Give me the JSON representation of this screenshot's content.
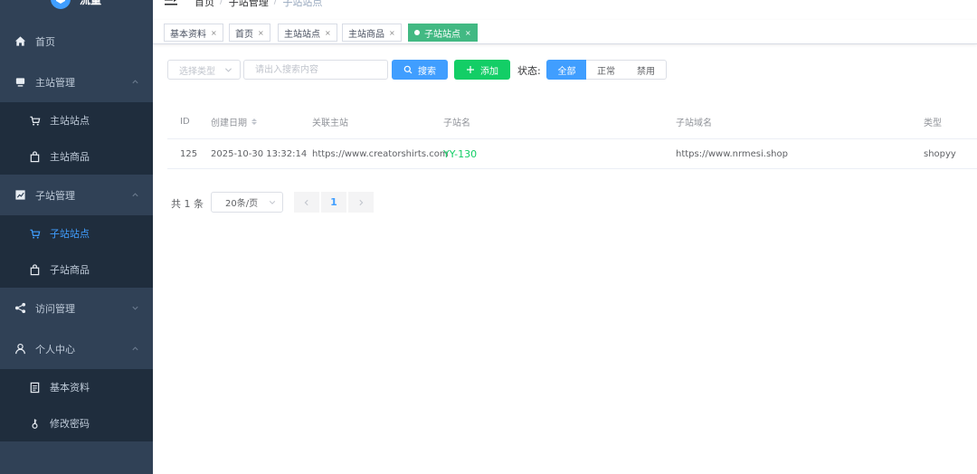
{
  "app": {
    "logo_text": "流量"
  },
  "sidebar": {
    "items": [
      {
        "label": "首页"
      },
      {
        "label": "主站管理"
      },
      {
        "label": "主站站点"
      },
      {
        "label": "主站商品"
      },
      {
        "label": "子站管理"
      },
      {
        "label": "子站站点"
      },
      {
        "label": "子站商品"
      },
      {
        "label": "访问管理"
      },
      {
        "label": "个人中心"
      },
      {
        "label": "基本资料"
      },
      {
        "label": "修改密码"
      }
    ],
    "active_item": "子站站点"
  },
  "breadcrumb": {
    "items": [
      "首页",
      "子站管理",
      "子站站点"
    ],
    "separator": "/"
  },
  "tags": {
    "items": [
      {
        "label": "基本资料"
      },
      {
        "label": "首页"
      },
      {
        "label": "主站站点"
      },
      {
        "label": "主站商品"
      },
      {
        "label": "子站站点"
      }
    ],
    "close_glyph": "×",
    "active_tag": "子站站点"
  },
  "toolbar": {
    "type_select_placeholder": "选择类型",
    "search_placeholder": "请出入搜索内容",
    "search_button": "搜索",
    "add_button": "添加",
    "status_label": "状态:",
    "status_options": [
      "全部",
      "正常",
      "禁用"
    ],
    "status_selected": "全部"
  },
  "table": {
    "columns": [
      "ID",
      "创建日期",
      "关联主站",
      "子站名",
      "子站域名",
      "类型"
    ],
    "rows": [
      {
        "id": "125",
        "created": "2025-10-30 13:32:14",
        "main_site": "https://www.creatorshirts.com",
        "sub_name": "YY-130",
        "sub_domain": "https://www.nrmesi.shop",
        "type": "shopyy"
      }
    ]
  },
  "pagination": {
    "total": "共 1 条",
    "page_size": "20条/页",
    "current_page": "1"
  },
  "colors": {
    "sidebar_bg": "#304156",
    "submenu_bg": "#1f2d3d",
    "primary": "#409eff",
    "success": "#13ce66",
    "active_tag": "#42b983"
  }
}
